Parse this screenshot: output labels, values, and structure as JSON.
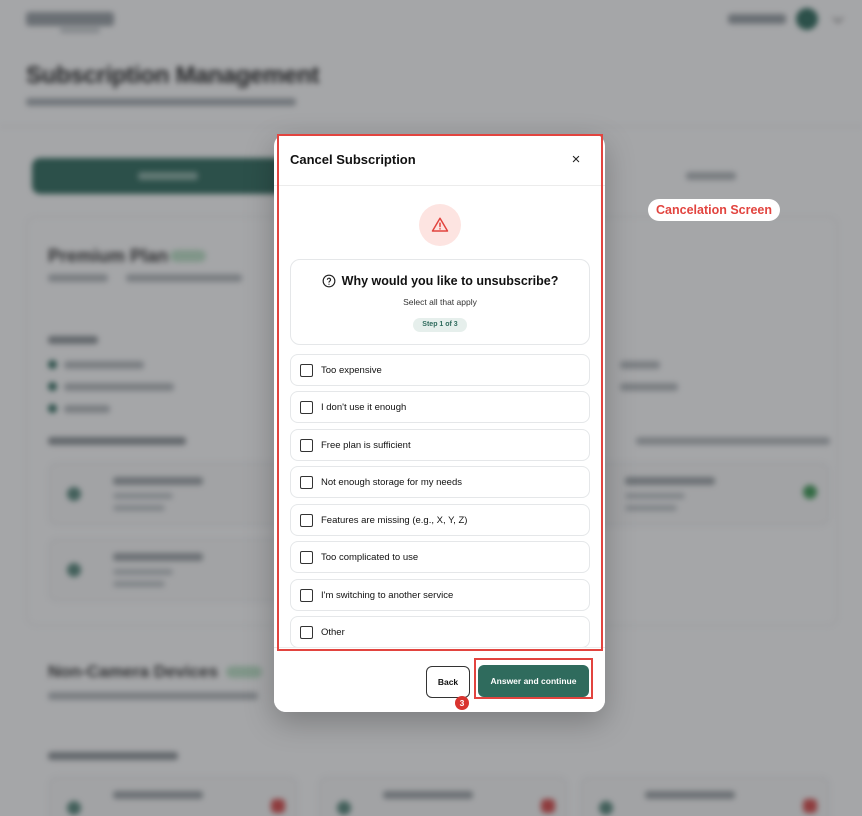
{
  "background": {
    "page_title": "Subscription Management",
    "plan_title": "Premium Plan",
    "section_title": "Non-Camera Devices"
  },
  "modal": {
    "title": "Cancel Subscription",
    "close_label": "×",
    "question": "Why would you like to unsubscribe?",
    "subtitle": "Select all that apply",
    "step": "Step 1 of 3",
    "options": [
      {
        "label": "Too expensive",
        "checked": false
      },
      {
        "label": "I don't use it enough",
        "checked": false
      },
      {
        "label": "Free plan is sufficient",
        "checked": false
      },
      {
        "label": "Not enough storage for my needs",
        "checked": false
      },
      {
        "label": "Features are missing (e.g., X, Y, Z)",
        "checked": false
      },
      {
        "label": "Too complicated to use",
        "checked": false
      },
      {
        "label": "I'm switching to another service",
        "checked": false
      },
      {
        "label": "Other",
        "checked": false
      }
    ],
    "back_label": "Back",
    "continue_label": "Answer and continue"
  },
  "annotations": {
    "screen_label": "Cancelation Screen",
    "step_number": "3"
  },
  "colors": {
    "accent": "#2f6b5d",
    "annotation": "#e2443f",
    "warning_bg": "#fde4e1"
  },
  "icons": {
    "warning": "warning-triangle-icon",
    "question": "question-circle-icon",
    "close": "close-icon"
  }
}
